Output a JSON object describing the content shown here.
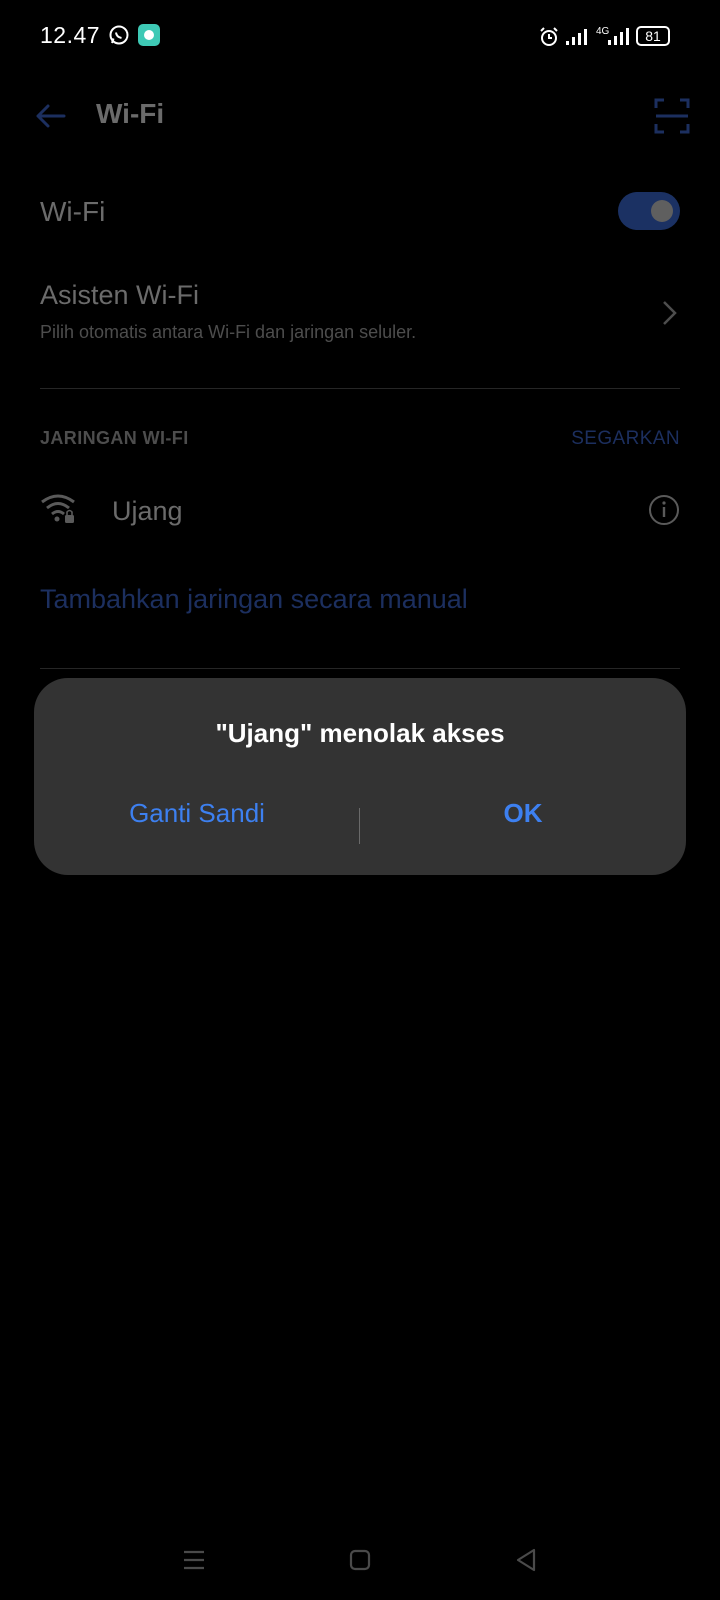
{
  "status_bar": {
    "time": "12.47",
    "battery": "81",
    "network_label": "4G",
    "icons": [
      "whatsapp-icon",
      "chat-app-icon",
      "alarm-icon",
      "signal-icon",
      "signal-4g-icon",
      "battery-icon"
    ]
  },
  "app_bar": {
    "title": "Wi-Fi",
    "back_icon": "arrow-left-icon",
    "scan_icon": "qr-scan-icon"
  },
  "wifi_row": {
    "label": "Wi-Fi",
    "enabled": true
  },
  "assistant_row": {
    "title": "Asisten Wi-Fi",
    "subtitle": "Pilih otomatis antara Wi-Fi dan jaringan seluler."
  },
  "networks": {
    "header": "JARINGAN WI-FI",
    "refresh_label": "SEGARKAN",
    "items": [
      {
        "name": "Ujang",
        "secured": true
      }
    ],
    "add_manual": "Tambahkan jaringan secara manual"
  },
  "dialog": {
    "title": "\"Ujang\" menolak akses",
    "left_button": "Ganti Sandi",
    "right_button": "OK"
  },
  "colors": {
    "accent": "#3d80f0",
    "dialog_bg": "#333333",
    "background": "#000000"
  },
  "nav_bar": {
    "icons": [
      "menu-icon",
      "home-icon",
      "back-icon"
    ]
  }
}
